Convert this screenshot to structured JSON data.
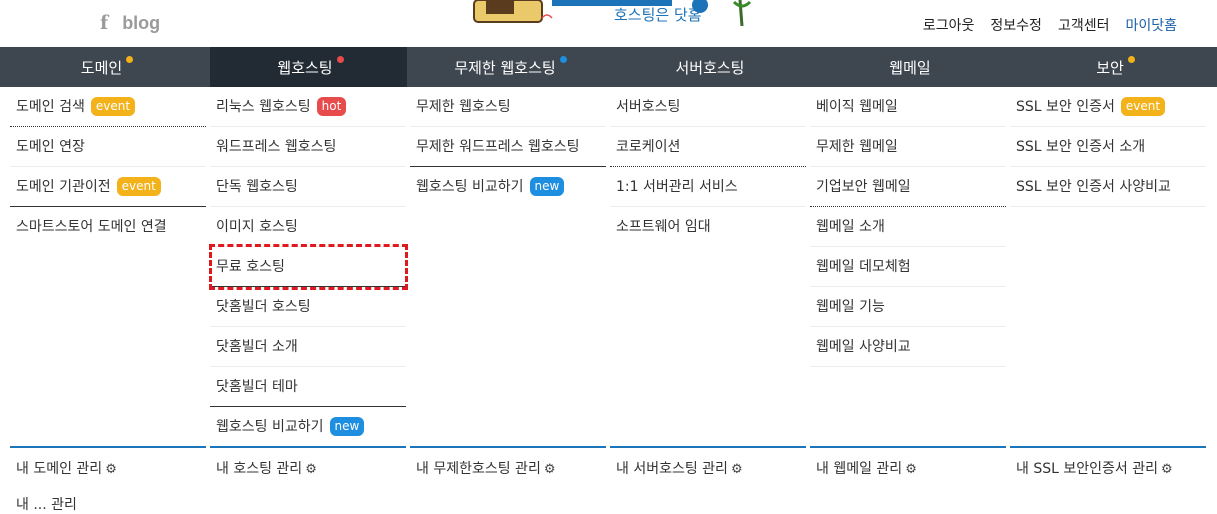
{
  "header": {
    "social": {
      "facebook": "f",
      "blog": "blog"
    },
    "logo": {
      "tagline": "호스팅은 닷홈"
    },
    "utility_links": [
      "로그아웃",
      "정보수정",
      "고객센터",
      "마이닷홈"
    ]
  },
  "gnb": {
    "tabs": [
      {
        "label": "도메인",
        "dot_color": "#f3b11a"
      },
      {
        "label": "웹호스팅",
        "dot_color": "#e84b4b"
      },
      {
        "label": "무제한 웹호스팅",
        "dot_color": "#1e8ee0"
      },
      {
        "label": "서버호스팅",
        "dot_color": ""
      },
      {
        "label": "웹메일",
        "dot_color": ""
      },
      {
        "label": "보안",
        "dot_color": "#f3b11a"
      }
    ]
  },
  "menus": {
    "domain": [
      {
        "label": "도메인 검색",
        "badge": "event"
      },
      {
        "label": "도메인 연장"
      },
      {
        "label": "도메인 기관이전",
        "badge": "event"
      },
      {
        "label": "스마트스토어 도메인 연결"
      }
    ],
    "webhosting": [
      {
        "label": "리눅스 웹호스팅",
        "badge": "hot"
      },
      {
        "label": "워드프레스 웹호스팅"
      },
      {
        "label": "단독 웹호스팅"
      },
      {
        "label": "이미지 호스팅"
      },
      {
        "label": "무료 호스팅"
      },
      {
        "label": "닷홈빌더 호스팅"
      },
      {
        "label": "닷홈빌더 소개"
      },
      {
        "label": "닷홈빌더 테마"
      },
      {
        "label": "웹호스팅 비교하기",
        "badge": "new"
      }
    ],
    "unlimited": [
      {
        "label": "무제한 웹호스팅"
      },
      {
        "label": "무제한 워드프레스 웹호스팅"
      },
      {
        "label": "웹호스팅 비교하기",
        "badge": "new"
      }
    ],
    "server": [
      {
        "label": "서버호스팅"
      },
      {
        "label": "코로케이션"
      },
      {
        "label": "1:1 서버관리 서비스"
      },
      {
        "label": "소프트웨어 임대"
      }
    ],
    "webmail": [
      {
        "label": "베이직 웹메일"
      },
      {
        "label": "무제한 웹메일"
      },
      {
        "label": "기업보안 웹메일"
      },
      {
        "label": "웹메일 소개"
      },
      {
        "label": "웹메일 데모체험"
      },
      {
        "label": "웹메일 기능"
      },
      {
        "label": "웹메일 사양비교"
      }
    ],
    "security": [
      {
        "label": "SSL 보안 인증서",
        "badge": "event"
      },
      {
        "label": "SSL 보안 인증서 소개"
      },
      {
        "label": "SSL 보안 인증서 사양비교"
      }
    ]
  },
  "footer_links": [
    "내 도메인 관리",
    "내 호스팅 관리",
    "내 무제한호스팅 관리",
    "내 서버호스팅 관리",
    "내 웹메일 관리",
    "내 SSL 보안인증서 관리"
  ],
  "cut_off_text": "내 ... 관리"
}
